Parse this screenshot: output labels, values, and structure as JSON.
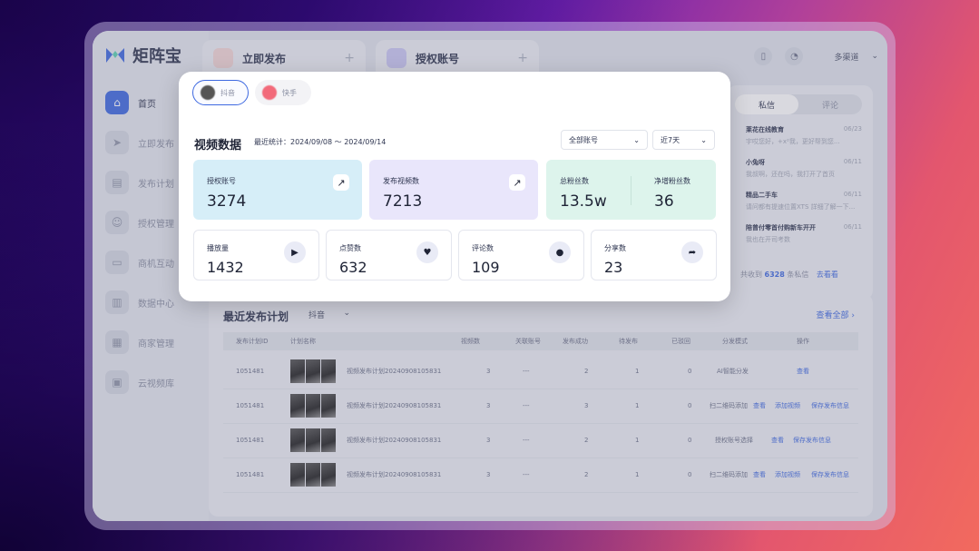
{
  "app": {
    "logo_text": "矩阵宝",
    "top_tabs": [
      {
        "label": "立即发布"
      },
      {
        "label": "授权账号"
      }
    ],
    "user_name": "多渠道"
  },
  "sidebar": {
    "items": [
      {
        "label": "首页",
        "icon": "home-icon"
      },
      {
        "label": "立即发布",
        "icon": "send-icon"
      },
      {
        "label": "发布计划",
        "icon": "plan-icon"
      },
      {
        "label": "授权管理",
        "icon": "user-icon"
      },
      {
        "label": "商机互动",
        "icon": "chat-icon"
      },
      {
        "label": "数据中心",
        "icon": "chart-icon"
      },
      {
        "label": "商家管理",
        "icon": "store-icon"
      },
      {
        "label": "云视频库",
        "icon": "video-icon"
      }
    ]
  },
  "messages": {
    "tabs": [
      "私信",
      "评论"
    ],
    "items": [
      {
        "name": "莱花在线教育",
        "date": "06/23",
        "text": "宇哎您好，+x²我，更好帮到您..."
      },
      {
        "name": "小兔呀",
        "date": "06/11",
        "text": "我叔啊，还在吗，我打开了首页"
      },
      {
        "name": "精品二手车",
        "date": "06/11",
        "text": "请问都有提速位置XTS 詳细了解一下..."
      },
      {
        "name": "陪曾付零首付购新车开开",
        "date": "06/11",
        "text": "我也在开司考数"
      }
    ],
    "footer_prefix": "共收到",
    "footer_count": "6328",
    "footer_suffix": "条私信",
    "footer_link": "去看看"
  },
  "plans": {
    "title": "最近发布计划",
    "platform": "抖音",
    "view_all": "查看全部",
    "columns": [
      "发布计划ID",
      "计划名称",
      "视频数",
      "关联账号",
      "发布成功",
      "待发布",
      "已驳回",
      "分发模式",
      "操作"
    ],
    "rows": [
      {
        "id": "1051481",
        "name": "视频发布计划20240908105831",
        "videos": "3",
        "accounts": "---",
        "success": "2",
        "pending": "1",
        "rejected": "0",
        "mode": "AI智能分发",
        "actions": [
          "查看"
        ]
      },
      {
        "id": "1051481",
        "name": "视频发布计划20240908105831",
        "videos": "3",
        "accounts": "---",
        "success": "3",
        "pending": "1",
        "rejected": "0",
        "mode": "扫二维码添加",
        "actions": [
          "查看",
          "添加视频",
          "保存发布信息"
        ]
      },
      {
        "id": "1051481",
        "name": "视频发布计划20240908105831",
        "videos": "3",
        "accounts": "---",
        "success": "2",
        "pending": "1",
        "rejected": "0",
        "mode": "授权账号选择",
        "actions": [
          "查看",
          "保存发布信息"
        ]
      },
      {
        "id": "1051481",
        "name": "视频发布计划20240908105831",
        "videos": "3",
        "accounts": "---",
        "success": "2",
        "pending": "1",
        "rejected": "0",
        "mode": "扫二维码添加",
        "actions": [
          "查看",
          "添加视频",
          "保存发布信息"
        ]
      }
    ]
  },
  "modal": {
    "platform_tabs": [
      {
        "label": "抖音"
      },
      {
        "label": "快手"
      }
    ],
    "title": "视频数据",
    "range_label": "最近统计：2024/09/08 ～ 2024/09/14",
    "account_select": "全部账号",
    "period_select": "近7天",
    "cards": {
      "authorized": {
        "label": "授权账号",
        "value": "3274"
      },
      "published": {
        "label": "发布视频数",
        "value": "7213"
      },
      "fans_total": {
        "label": "总粉丝数",
        "value": "13.5w"
      },
      "fans_net": {
        "label": "净增粉丝数",
        "value": "36"
      }
    },
    "stats": [
      {
        "label": "播放量",
        "value": "1432",
        "icon": "play-icon"
      },
      {
        "label": "点赞数",
        "value": "632",
        "icon": "heart-icon"
      },
      {
        "label": "评论数",
        "value": "109",
        "icon": "comment-icon"
      },
      {
        "label": "分享数",
        "value": "23",
        "icon": "share-icon"
      }
    ]
  }
}
